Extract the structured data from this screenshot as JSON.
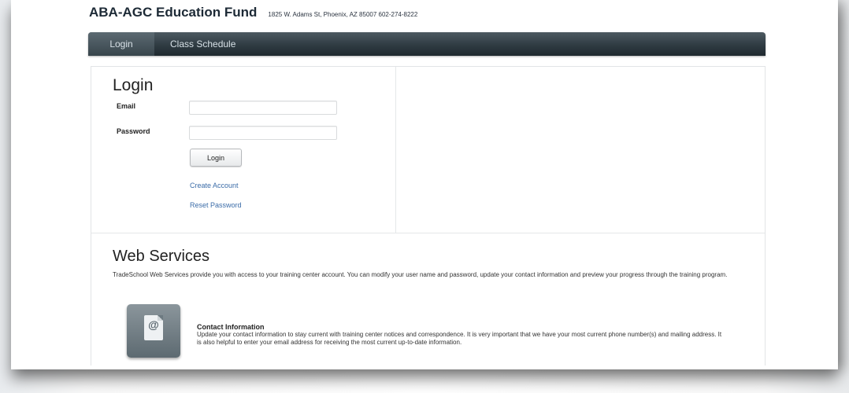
{
  "header": {
    "brand": "ABA-AGC Education Fund",
    "address": "1825 W. Adams St, Phoenix, AZ 85007   602-274-8222"
  },
  "nav": {
    "tabs": [
      {
        "label": "Login",
        "active": true
      },
      {
        "label": "Class Schedule",
        "active": false
      }
    ]
  },
  "login": {
    "title": "Login",
    "email_label": "Email",
    "email_value": "",
    "password_label": "Password",
    "password_value": "",
    "button_label": "Login",
    "create_account": "Create Account",
    "reset_password": "Reset Password"
  },
  "web_services": {
    "title": "Web Services",
    "description": "TradeSchool Web Services provide you with access to your training center account. You can modify your user name and password, update your contact information and preview your progress through the training program.",
    "items": [
      {
        "icon": "contact-document-icon",
        "title": "Contact Information",
        "description": "Update your contact information to stay current with training center notices and correspondence. It is very important that we have your most current phone number(s) and mailing address. It is also helpful to enter your email address for receiving the most current up-to-date information."
      }
    ]
  },
  "colors": {
    "nav_bg": "#2f3b42",
    "link": "#3b6ca8",
    "brand_text": "#1d2a36"
  }
}
